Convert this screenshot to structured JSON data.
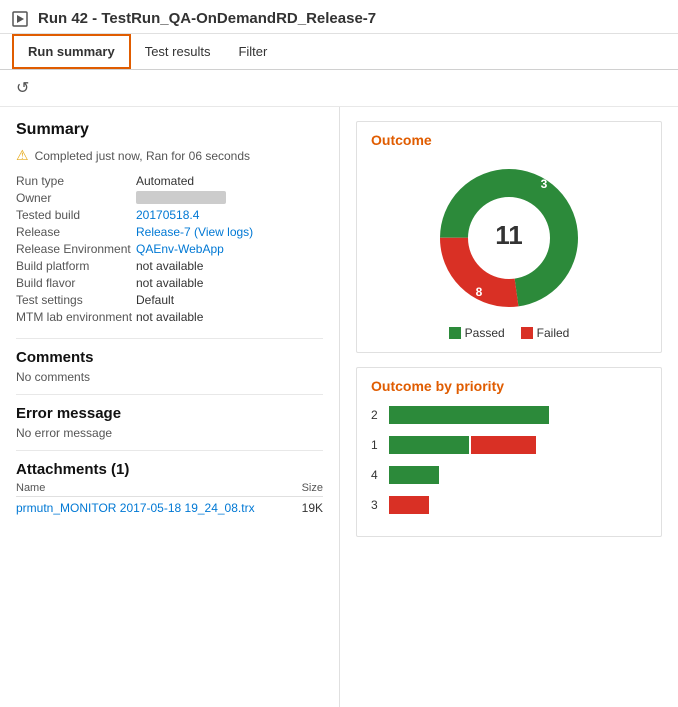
{
  "header": {
    "title": "Run 42 - TestRun_QA-OnDemandRD_Release-7"
  },
  "tabs": [
    {
      "id": "run-summary",
      "label": "Run summary",
      "active": true
    },
    {
      "id": "test-results",
      "label": "Test results",
      "active": false
    },
    {
      "id": "filter",
      "label": "Filter",
      "active": false
    }
  ],
  "toolbar": {
    "refresh_icon": "↺"
  },
  "summary": {
    "section_title": "Summary",
    "warning_text": "Completed just now, Ran for 06 seconds",
    "fields": [
      {
        "label": "Run type",
        "value": "Automated",
        "type": "text"
      },
      {
        "label": "Owner",
        "value": "████ ██████████",
        "type": "blurred"
      },
      {
        "label": "Tested build",
        "value": "20170518.4",
        "type": "link"
      },
      {
        "label": "Release",
        "value": "Release-7 (View logs)",
        "type": "link"
      },
      {
        "label": "Release Environment",
        "value": "QAEnv-WebApp",
        "type": "link"
      },
      {
        "label": "Build platform",
        "value": "not available",
        "type": "text"
      },
      {
        "label": "Build flavor",
        "value": "not available",
        "type": "text"
      },
      {
        "label": "Test settings",
        "value": "Default",
        "type": "text"
      },
      {
        "label": "MTM lab environment",
        "value": "not available",
        "type": "text"
      }
    ]
  },
  "comments": {
    "title": "Comments",
    "text": "No comments"
  },
  "error_message": {
    "title": "Error message",
    "text": "No error message"
  },
  "attachments": {
    "title": "Attachments (1)",
    "col_name": "Name",
    "col_size": "Size",
    "items": [
      {
        "name": "prmutn_MONITOR 2017-05-18 19_24_08.trx",
        "size": "19K"
      }
    ]
  },
  "outcome": {
    "title": "Outcome",
    "total": "11",
    "passed": 8,
    "failed": 3,
    "legend": [
      {
        "label": "Passed",
        "color": "#2c8a3a"
      },
      {
        "label": "Failed",
        "color": "#d93025"
      }
    ]
  },
  "outcome_by_priority": {
    "title": "Outcome by priority",
    "rows": [
      {
        "priority": "2",
        "passed_pct": 100,
        "failed_pct": 0,
        "passed_w": 160,
        "failed_w": 0
      },
      {
        "priority": "1",
        "passed_pct": 55,
        "failed_pct": 45,
        "passed_w": 80,
        "failed_w": 65
      },
      {
        "priority": "4",
        "passed_pct": 100,
        "failed_pct": 0,
        "passed_w": 50,
        "failed_w": 0
      },
      {
        "priority": "3",
        "passed_pct": 0,
        "failed_pct": 100,
        "passed_w": 0,
        "failed_w": 40
      }
    ]
  }
}
